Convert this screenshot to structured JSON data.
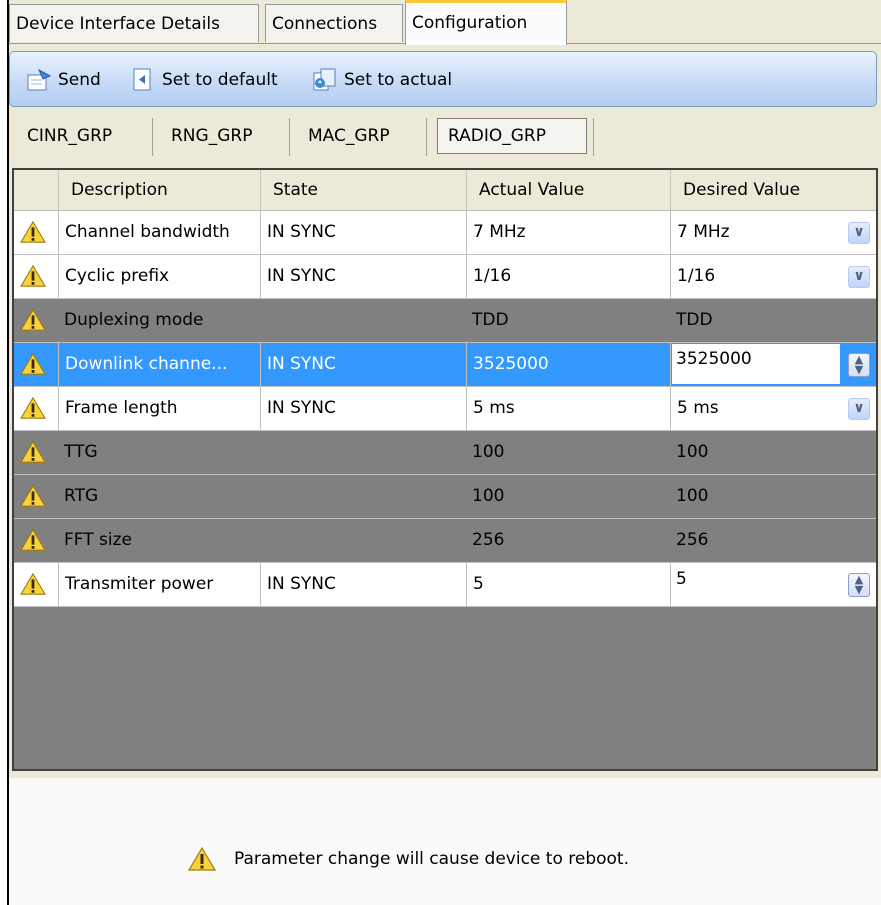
{
  "tabs": [
    "Device Interface Details",
    "Connections",
    "Configuration"
  ],
  "active_tab": "Configuration",
  "toolbar": {
    "send_label": "Send",
    "set_default_label": "Set to default",
    "set_actual_label": "Set to actual"
  },
  "groups": [
    "CINR_GRP",
    "RNG_GRP",
    "MAC_GRP",
    "RADIO_GRP"
  ],
  "active_group": "RADIO_GRP",
  "columns": [
    "Description",
    "State",
    "Actual Value",
    "Desired Value"
  ],
  "rows": [
    {
      "description": "Channel bandwidth",
      "state": "IN SYNC",
      "actual": "7 MHz",
      "desired": "7 MHz",
      "editor": "dropdown",
      "style": "normal"
    },
    {
      "description": "Cyclic prefix",
      "state": "IN SYNC",
      "actual": "1/16",
      "desired": "1/16",
      "editor": "dropdown",
      "style": "normal"
    },
    {
      "description": "Duplexing mode",
      "state": "",
      "actual": "TDD",
      "desired": "TDD",
      "editor": "none",
      "style": "disabled"
    },
    {
      "description": "Downlink channe...",
      "state": "IN SYNC",
      "actual": "3525000",
      "desired": "3525000",
      "editor": "spinner",
      "style": "selected"
    },
    {
      "description": "Frame length",
      "state": "IN SYNC",
      "actual": "5 ms",
      "desired": "5 ms",
      "editor": "dropdown",
      "style": "normal"
    },
    {
      "description": "TTG",
      "state": "",
      "actual": "100",
      "desired": "100",
      "editor": "none",
      "style": "disabled"
    },
    {
      "description": "RTG",
      "state": "",
      "actual": "100",
      "desired": "100",
      "editor": "none",
      "style": "disabled"
    },
    {
      "description": "FFT size",
      "state": "",
      "actual": "256",
      "desired": "256",
      "editor": "none",
      "style": "disabled"
    },
    {
      "description": "Transmiter power",
      "state": "IN SYNC",
      "actual": "5",
      "desired": "5",
      "editor": "spinner",
      "style": "normal"
    }
  ],
  "notice": "Parameter change will cause device to reboot.",
  "icons": {
    "row": "warning-icon",
    "dropdown": "chevron-down-icon",
    "spinner": "spinner-arrows-icon"
  },
  "colors": {
    "selected_row": "#3399ff",
    "disabled_row": "#808080",
    "toolbar": "#c4d9f6"
  }
}
